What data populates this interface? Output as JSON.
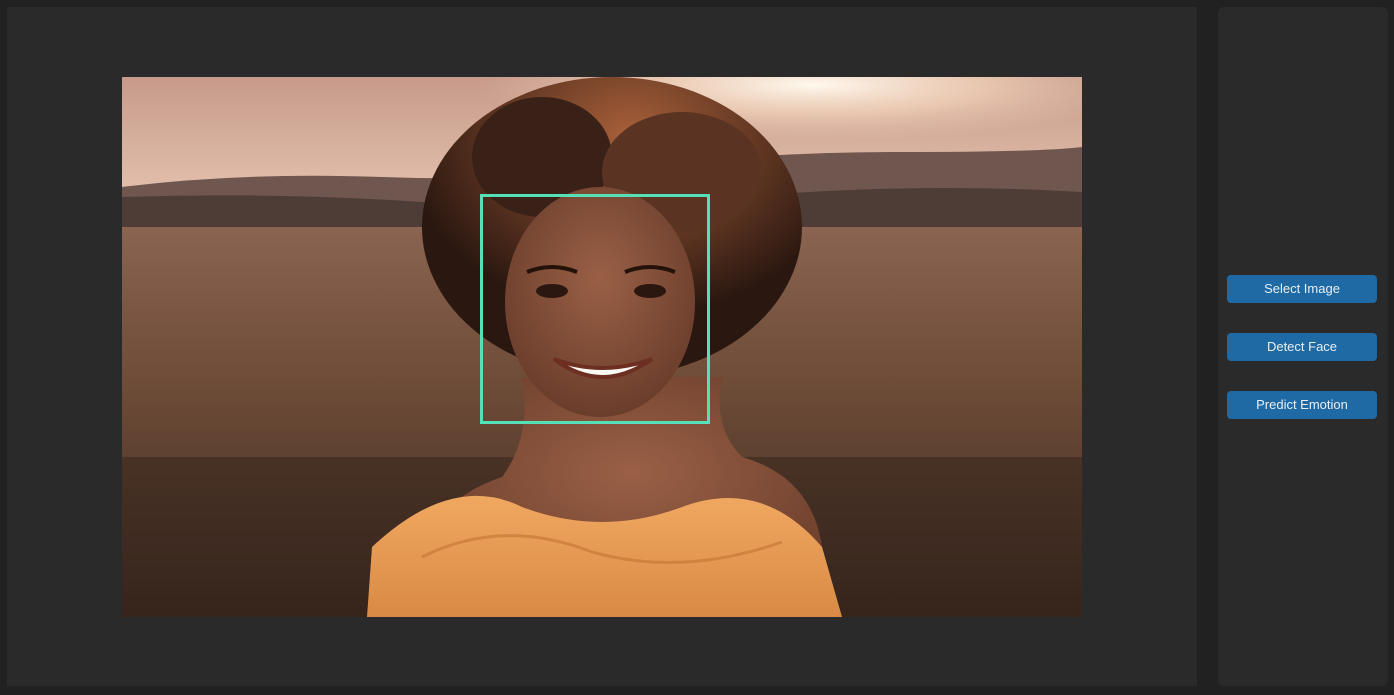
{
  "theme": {
    "background": "#212121",
    "panel": "#2a2a2a",
    "accent": "#1f6aa5",
    "face_box": "#55e0b8"
  },
  "image_view": {
    "subject": "portrait of smiling woman with curly hair in a field at sunset",
    "detection": "face bounding box"
  },
  "controls": {
    "select_image": "Select Image",
    "detect_face": "Detect Face",
    "predict_emotion": "Predict Emotion"
  }
}
